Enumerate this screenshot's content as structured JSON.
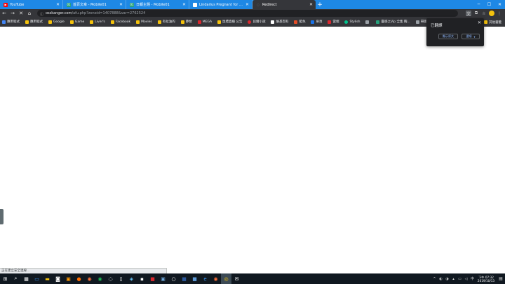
{
  "browser": {
    "tabs": [
      {
        "label": "YouTube",
        "favicon_color": "#ff0000",
        "favicon_glyph": "▶"
      },
      {
        "label": "首頁文章 - Mobile01",
        "favicon_color": "#26a17b",
        "favicon_glyph": "01"
      },
      {
        "label": "日報主題 - Mobile01",
        "favicon_color": "#26a17b",
        "favicon_glyph": "01"
      },
      {
        "label": "Lindarius Pregnant for GTA Sa",
        "favicon_color": "#ffffff",
        "favicon_glyph": ""
      },
      {
        "label": "Redirect",
        "favicon_color": "#9aa0a6",
        "favicon_glyph": "◌"
      }
    ],
    "new_tab_glyph": "+",
    "window_controls": {
      "minimize": "─",
      "maximize": "☐",
      "close": "✕"
    }
  },
  "toolbar": {
    "back_glyph": "←",
    "forward_glyph": "→",
    "stop_glyph": "✕",
    "home_glyph": "⌂",
    "url_host": "osskanger.com",
    "url_path": "/afu.php?zoneid=1407888&var=2762524",
    "extension_icons": [
      "translate-icon",
      "extension-icon",
      "star-icon",
      "avatar",
      "menu-icon"
    ],
    "star_glyph": "☆",
    "menu_glyph": "⋮"
  },
  "bookmarks": {
    "items": [
      {
        "label": "應用程式",
        "icon_color": "#4285f4"
      },
      {
        "label": "應用程式",
        "icon_color": "#f4c20d"
      },
      {
        "label": "Google",
        "icon_color": "#f4c20d"
      },
      {
        "label": "Game",
        "icon_color": "#f4c20d"
      },
      {
        "label": "Liver's",
        "icon_color": "#f4c20d"
      },
      {
        "label": "Facebook",
        "icon_color": "#f4c20d"
      },
      {
        "label": "Movies",
        "icon_color": "#f4c20d"
      },
      {
        "label": "有拉油的",
        "icon_color": "#f4c20d"
      },
      {
        "label": "夢想",
        "icon_color": "#f4c20d"
      },
      {
        "label": "MEGA",
        "icon_color": "#d9272e"
      },
      {
        "label": "鼠標直播 公告",
        "icon_color": "#f4c20d"
      },
      {
        "label": "貝爾小說",
        "icon_color": "#d9272e"
      },
      {
        "label": "維基百科",
        "icon_color": "#ffffff"
      },
      {
        "label": "藍色",
        "icon_color": "#e34c26"
      },
      {
        "label": "扉頁",
        "icon_color": "#1a73e8"
      },
      {
        "label": "雲端",
        "icon_color": "#d9272e"
      },
      {
        "label": "Stylish",
        "icon_color": "#00c28b"
      },
      {
        "label": "",
        "icon_color": "#9aa0a6"
      },
      {
        "label": "靈感之Vip 全集 胸...",
        "icon_color": "#26a17b"
      },
      {
        "label": "帶圖",
        "icon_color": "#9aa0a6"
      }
    ],
    "other_label": "其他書籤"
  },
  "translate_popup": {
    "title": "已翻譯",
    "show_original_label": "顯示原文",
    "options_label": "選項",
    "close_glyph": "✕"
  },
  "status_bar": {
    "text": "正在建立安全連線..."
  },
  "taskbar": {
    "start_glyph": "⊞",
    "icons": [
      "search-icon",
      "task-view-icon",
      "edge-icon",
      "file-explorer-icon",
      "store-icon",
      "photos-icon",
      "vlc-icon",
      "firefox-icon",
      "spotify-icon",
      "media-icon",
      "settings-icon",
      "steam-icon",
      "terminal-icon",
      "app-icon",
      "virtualbox-icon",
      "circle-icon",
      "word-icon",
      "app2-icon",
      "edge2-icon",
      "firefox2-icon",
      "chrome-icon",
      "mail-icon"
    ],
    "clock": {
      "time": "下午 07:32",
      "date": "2019/10/13"
    },
    "tray_up_glyph": "^",
    "notification_glyph": "▤"
  },
  "colors": {
    "tabstrip": "#1e88e5",
    "chrome_dark": "#35363a",
    "taskbar": "#101820"
  }
}
